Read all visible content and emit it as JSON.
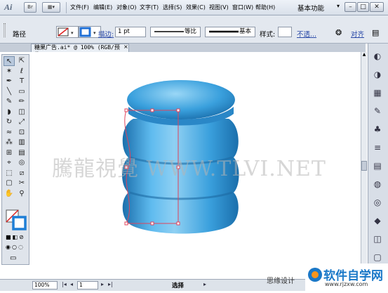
{
  "app": {
    "logo": "Ai"
  },
  "menubar": {
    "items": [
      "文件(F)",
      "编辑(E)",
      "对象(O)",
      "文字(T)",
      "选择(S)",
      "效果(C)",
      "视图(V)",
      "窗口(W)",
      "帮助(H)"
    ],
    "mode_btn": "Br",
    "workspace": "基本功能",
    "win_buttons": [
      "–",
      "□",
      "✕"
    ]
  },
  "controlbar": {
    "selection_label": "路径",
    "stroke_label": "描边:",
    "stroke_weight": "1 pt",
    "profile_label": "等比",
    "brush_label": "基本",
    "style_label": "样式:",
    "opacity_label": "不透...",
    "align_label": "对齐"
  },
  "document": {
    "tab_title": "糖果广告.ai* @ 100% (RGB/预览)",
    "close": "×"
  },
  "watermark": "騰龍視覺 WWW.TLVI.NET",
  "statusbar": {
    "zoom": "100%",
    "page": "1",
    "status": "选择"
  },
  "credit": {
    "author": "思缘设计"
  },
  "brand": {
    "name": "软件自学网",
    "url": "www.rjzxw.com"
  },
  "colors": {
    "jar_light": "#8fd0f3",
    "jar_mid": "#3aa0dd",
    "jar_dark": "#1a6eab",
    "path_red": "#e0445c",
    "brand_blue": "#1a78c8",
    "brand_orange": "#f7941d"
  },
  "tools": [
    {
      "name": "selection-tool",
      "glyph": "↖"
    },
    {
      "name": "direct-selection-tool",
      "glyph": "⇱"
    },
    {
      "name": "magic-wand-tool",
      "glyph": "✶"
    },
    {
      "name": "lasso-tool",
      "glyph": "ℓ"
    },
    {
      "name": "pen-tool",
      "glyph": "✒"
    },
    {
      "name": "type-tool",
      "glyph": "T"
    },
    {
      "name": "line-tool",
      "glyph": "╲"
    },
    {
      "name": "rectangle-tool",
      "glyph": "▭"
    },
    {
      "name": "paintbrush-tool",
      "glyph": "✎"
    },
    {
      "name": "pencil-tool",
      "glyph": "✏"
    },
    {
      "name": "blob-brush-tool",
      "glyph": "◗"
    },
    {
      "name": "eraser-tool",
      "glyph": "◫"
    },
    {
      "name": "rotate-tool",
      "glyph": "↻"
    },
    {
      "name": "scale-tool",
      "glyph": "⤢"
    },
    {
      "name": "warp-tool",
      "glyph": "≈"
    },
    {
      "name": "free-transform-tool",
      "glyph": "⊡"
    },
    {
      "name": "symbol-sprayer-tool",
      "glyph": "⁂"
    },
    {
      "name": "column-graph-tool",
      "glyph": "▥"
    },
    {
      "name": "mesh-tool",
      "glyph": "⊞"
    },
    {
      "name": "gradient-tool",
      "glyph": "▤"
    },
    {
      "name": "eyedropper-tool",
      "glyph": "⌖"
    },
    {
      "name": "blend-tool",
      "glyph": "◎"
    },
    {
      "name": "live-paint-tool",
      "glyph": "⬚"
    },
    {
      "name": "slice-tool",
      "glyph": "⧄"
    },
    {
      "name": "artboard-tool",
      "glyph": "▢"
    },
    {
      "name": "scissors-tool",
      "glyph": "✂"
    },
    {
      "name": "hand-tool",
      "glyph": "✋"
    },
    {
      "name": "zoom-tool",
      "glyph": "⚲"
    }
  ],
  "panel_icons": [
    "color-panel-icon",
    "color-guide-icon",
    "swatches-icon",
    "brushes-icon",
    "symbols-icon",
    "stroke-panel-icon",
    "gradient-panel-icon",
    "transparency-icon",
    "appearance-icon",
    "graphic-styles-icon",
    "layers-icon",
    "artboards-icon"
  ]
}
